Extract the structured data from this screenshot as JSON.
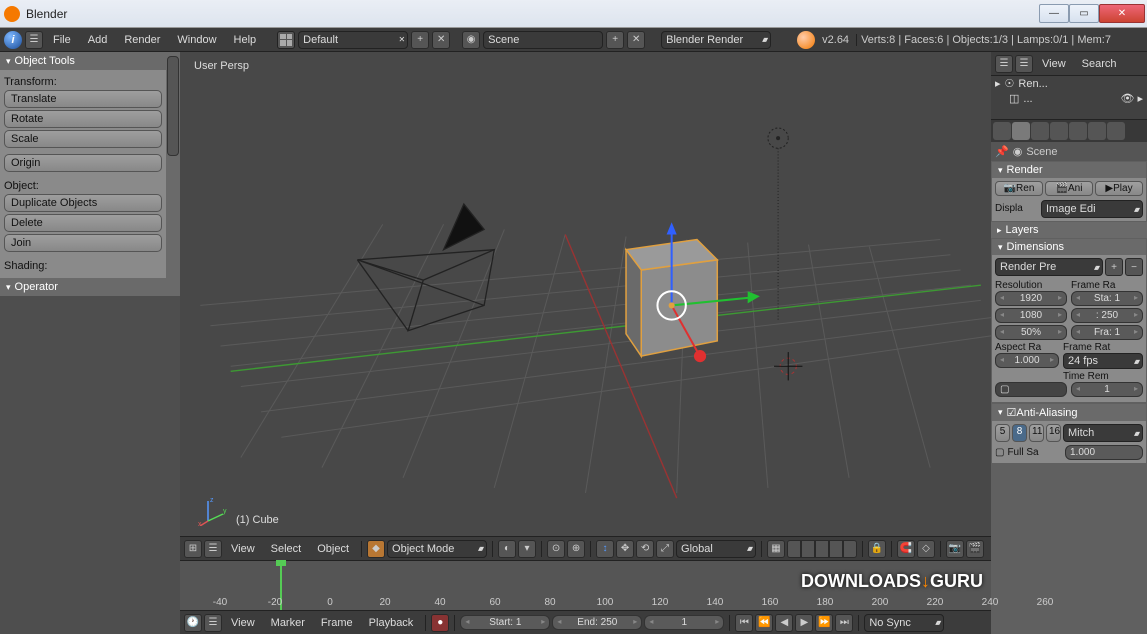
{
  "window": {
    "title": "Blender"
  },
  "topMenu": {
    "items": [
      "File",
      "Add",
      "Render",
      "Window",
      "Help"
    ],
    "layout": "Default",
    "scene": "Scene",
    "engine": "Blender Render",
    "version": "v2.64",
    "stats": "Verts:8 | Faces:6 | Objects:1/3 | Lamps:0/1 | Mem:7"
  },
  "toolShelf": {
    "header": "Object Tools",
    "transformLabel": "Transform:",
    "transformButtons": [
      "Translate",
      "Rotate",
      "Scale"
    ],
    "origin": "Origin",
    "objectLabel": "Object:",
    "objectButtons": [
      "Duplicate Objects",
      "Delete",
      "Join"
    ],
    "shadingLabel": "Shading:",
    "operator": "Operator"
  },
  "viewport": {
    "persp": "User Persp",
    "objectName": "(1) Cube"
  },
  "viewHeader": {
    "menus": [
      "View",
      "Select",
      "Object"
    ],
    "mode": "Object Mode",
    "orient": "Global"
  },
  "timeline": {
    "ticks": [
      -40,
      -20,
      0,
      20,
      40,
      60,
      80,
      100,
      120,
      140,
      160,
      180,
      200,
      220,
      240,
      260
    ],
    "current": 1
  },
  "timelineHeader": {
    "menus": [
      "View",
      "Marker",
      "Frame",
      "Playback"
    ],
    "start": "Start: 1",
    "end": "End: 250",
    "frame": "1",
    "sync": "No Sync"
  },
  "outlinerHeader": {
    "view": "View",
    "search": "Search"
  },
  "props": {
    "context": "Scene",
    "render": {
      "title": "Render",
      "buttons": [
        "Ren",
        "Ani",
        "Play"
      ],
      "displayLabel": "Displa",
      "display": "Image Edi"
    },
    "layers": "Layers",
    "dimensions": {
      "title": "Dimensions",
      "preset": "Render Pre",
      "resLabel": "Resolution",
      "res": [
        "1920",
        "1080",
        "50%"
      ],
      "frameLabel": "Frame Ra",
      "frame": [
        "Sta: 1",
        ": 250",
        "Fra: 1"
      ],
      "aspectLabel": "Aspect Ra",
      "aspect": "1.000",
      "rateLabel": "Frame Rat",
      "rate": "24 fps",
      "timeRemLabel": "Time Rem",
      "timeRem": "1"
    },
    "aa": {
      "title": "Anti-Aliasing",
      "samples": [
        "5",
        "8",
        "11",
        "16"
      ],
      "filter": "Mitch",
      "fullLabel": "Full Sa",
      "size": "1.000"
    }
  }
}
